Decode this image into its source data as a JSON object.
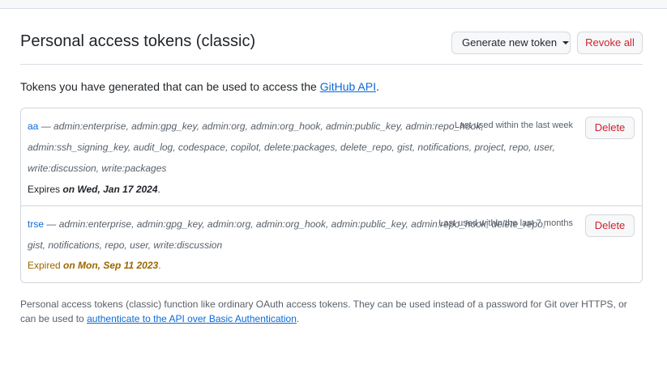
{
  "header": {
    "title": "Personal access tokens (classic)",
    "generate_label": "Generate new token",
    "revoke_label": "Revoke all"
  },
  "intro": {
    "text": "Tokens you have generated that can be used to access the ",
    "link": "GitHub API",
    "suffix": "."
  },
  "tokens": [
    {
      "name": "aa",
      "scopes": "admin:enterprise, admin:gpg_key, admin:org, admin:org_hook, admin:public_key, admin:repo_hook, admin:ssh_signing_key, audit_log, codespace, copilot, delete:packages, delete_repo, gist, notifications, project, repo, user, write:discussion, write:packages",
      "last_used": "Last used within the last week",
      "expires_prefix": "Expires ",
      "expires_date": "on Wed, Jan 17 2024",
      "expires_suffix": ".",
      "delete_label": "Delete"
    },
    {
      "name": "trse",
      "scopes": "admin:enterprise, admin:gpg_key, admin:org, admin:org_hook, admin:public_key, admin:repo_hook, delete_repo, gist, notifications, repo, user, write:discussion",
      "last_used": "Last used within the last 7 months",
      "expires_prefix": "Expired ",
      "expires_date": "on Mon, Sep 11 2023",
      "expires_suffix": ".",
      "delete_label": "Delete"
    }
  ],
  "footer": {
    "text": "Personal access tokens (classic) function like ordinary OAuth access tokens. They can be used instead of a password for Git over HTTPS, or can be used to ",
    "link": "authenticate to the API over Basic Authentication",
    "suffix": "."
  },
  "colors": {
    "link": "#0969da",
    "danger": "#cf222e",
    "expired": "#9a6700"
  },
  "icons": {
    "generate_caret": "caret-down-icon"
  }
}
